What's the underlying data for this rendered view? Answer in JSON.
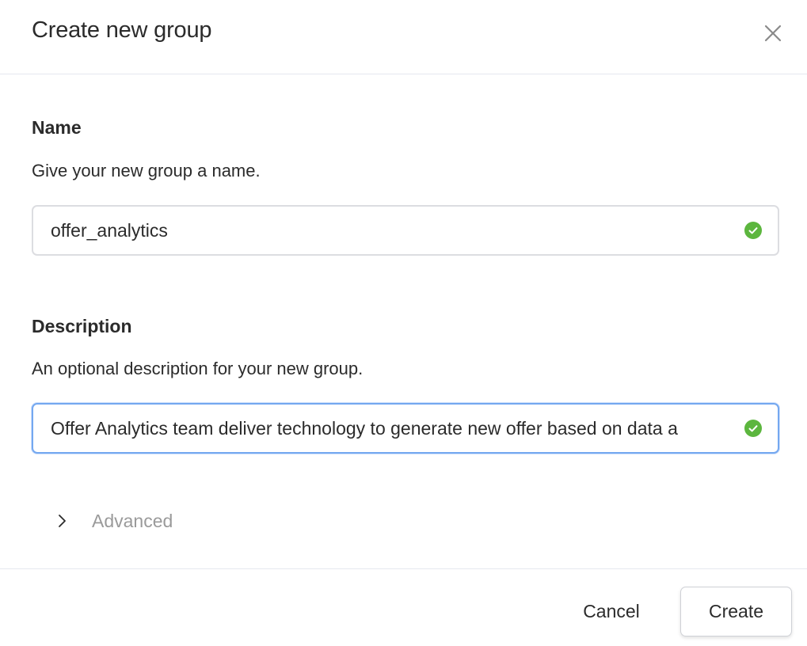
{
  "dialog": {
    "title": "Create new group",
    "close_icon": "close-icon"
  },
  "name_section": {
    "label": "Name",
    "help": "Give your new group a name.",
    "value": "offer_analytics",
    "valid_icon": "check-circle-icon"
  },
  "description_section": {
    "label": "Description",
    "help": "An optional description for your new group.",
    "value": "Offer Analytics team deliver technology to generate new offer based on data a",
    "valid_icon": "check-circle-icon"
  },
  "advanced": {
    "label": "Advanced",
    "icon": "chevron-right-icon"
  },
  "footer": {
    "cancel_label": "Cancel",
    "create_label": "Create"
  },
  "colors": {
    "valid_green": "#5cb63e",
    "focus_blue": "#74a8f0",
    "muted_text": "#9a9a9a"
  }
}
